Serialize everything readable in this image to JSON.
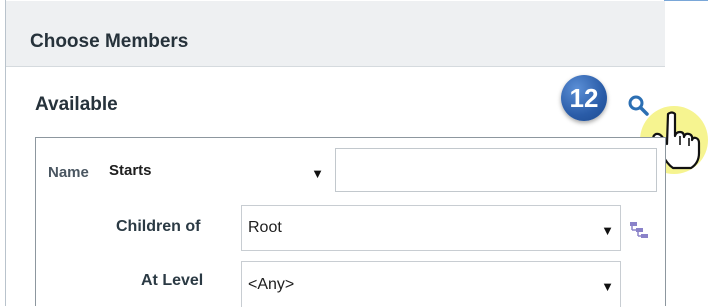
{
  "panel": {
    "title": "Choose Members",
    "available_title": "Available"
  },
  "annotation": {
    "step_number": "12",
    "icons": [
      "search-icon",
      "pointer-hand-icon"
    ]
  },
  "form": {
    "name_label": "Name",
    "name_operator": "Starts",
    "name_value": "",
    "children_of_label": "Children of",
    "children_of_value": "Root",
    "at_level_label": "At Level",
    "at_level_value": "<Any>"
  },
  "colors": {
    "badge": "#2a5ca8",
    "highlight": "#f6f38a",
    "header_bg": "#eef0f2"
  }
}
